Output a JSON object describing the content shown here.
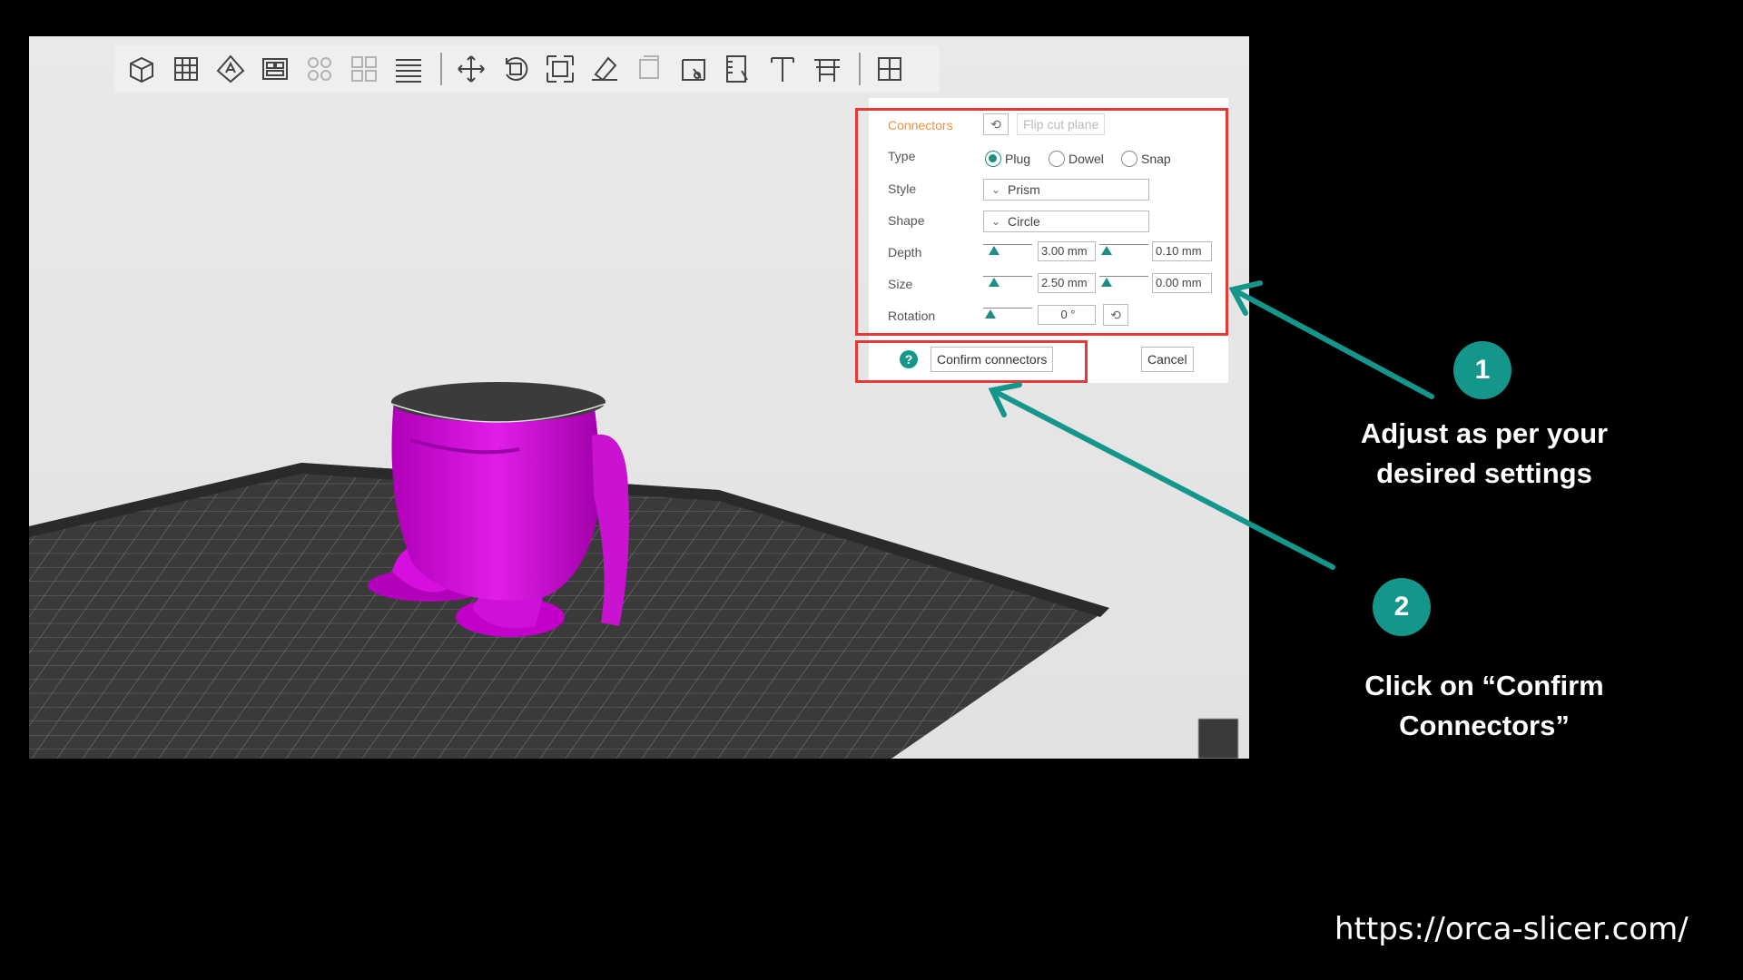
{
  "toolbar": {
    "tools": [
      "add-object-icon",
      "add-plate-icon",
      "auto-orient-icon",
      "arrange-icon",
      "split-objects-icon",
      "split-parts-icon",
      "layers-icon",
      "move-icon",
      "rotate-icon",
      "scale-icon",
      "lay-on-face-icon",
      "placement-icon",
      "cut-icon",
      "seam-painting-icon",
      "text-icon",
      "measure-icon",
      "assembly-icon"
    ]
  },
  "panel": {
    "connectors_label": "Connectors",
    "flip_label": "Flip cut plane",
    "type_label": "Type",
    "type_options": [
      "Plug",
      "Dowel",
      "Snap"
    ],
    "type_selected": "Plug",
    "style_label": "Style",
    "style_value": "Prism",
    "shape_label": "Shape",
    "shape_value": "Circle",
    "depth_label": "Depth",
    "depth_value": "3.00  mm",
    "depth_tolerance": "0.10  mm",
    "size_label": "Size",
    "size_value": "2.50  mm",
    "size_tolerance": "0.00  mm",
    "rotation_label": "Rotation",
    "rotation_value": "0 °",
    "confirm_label": "Confirm connectors",
    "cancel_label": "Cancel",
    "help_icon": "?"
  },
  "annotations": {
    "step1_number": "1",
    "step1_text": "Adjust as per your desired settings",
    "step2_number": "2",
    "step2_text": "Click on “Confirm Connectors”",
    "accent_color": "#15968a",
    "highlight_color": "#e53935"
  },
  "footer_url": "https://orca-slicer.com/"
}
